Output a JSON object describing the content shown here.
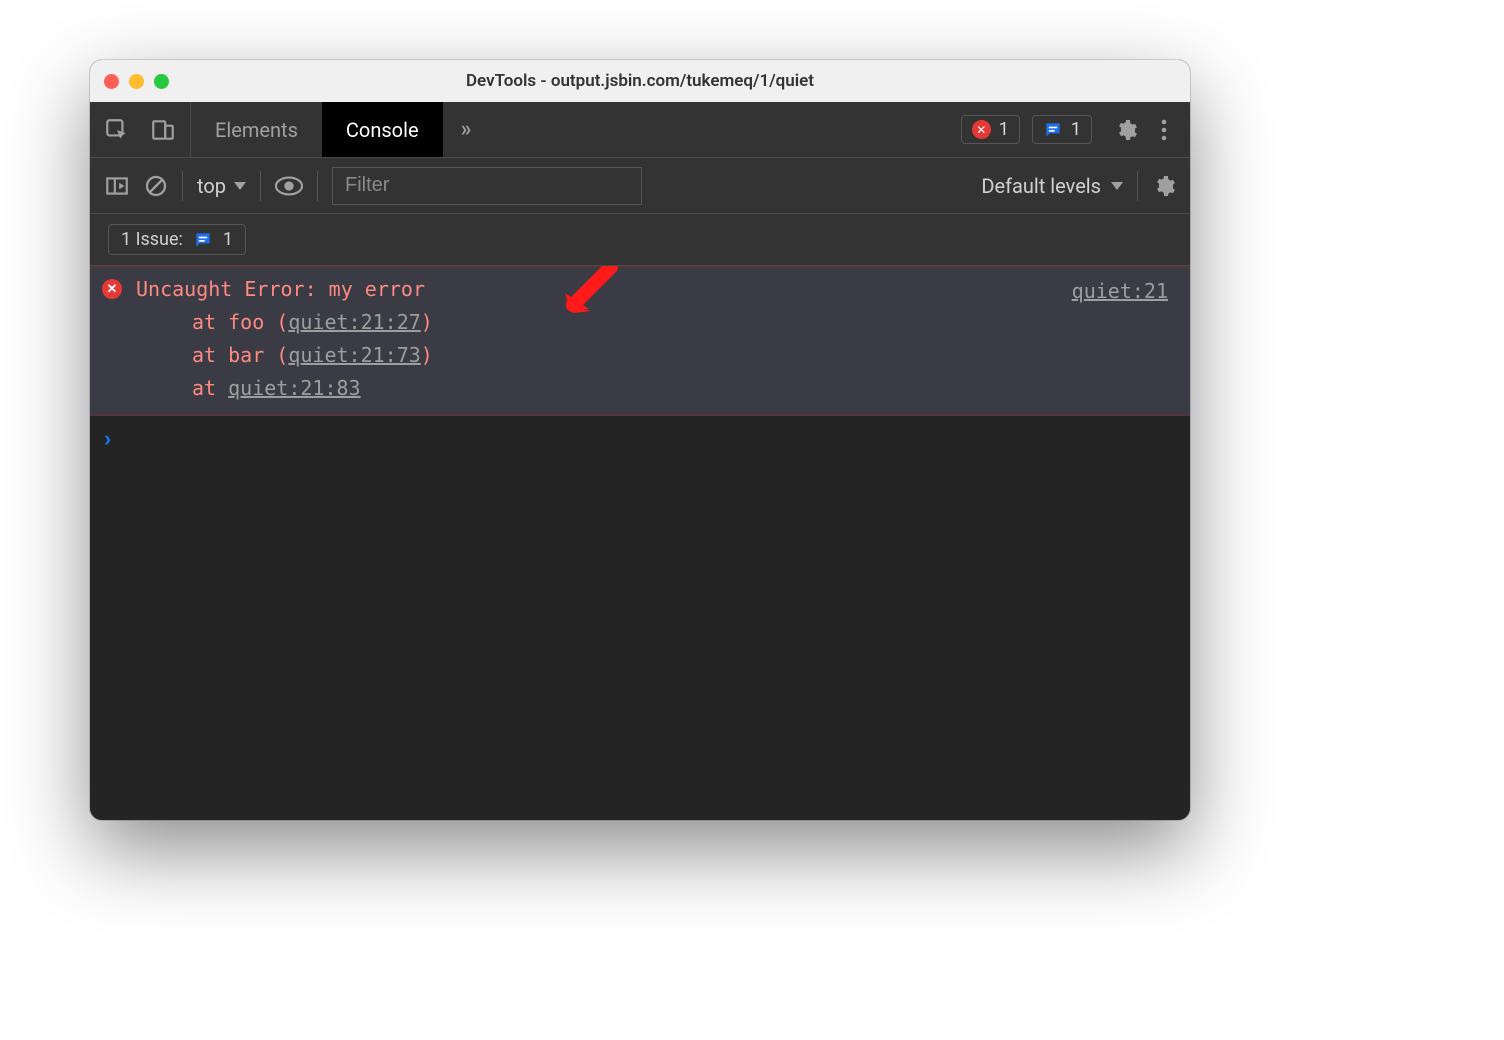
{
  "window": {
    "title": "DevTools - output.jsbin.com/tukemeq/1/quiet"
  },
  "tabs": {
    "elements": "Elements",
    "console": "Console",
    "expand_glyph": "»"
  },
  "badges": {
    "error_count": "1",
    "issue_count": "1"
  },
  "toolbar": {
    "context": "top",
    "filter_placeholder": "Filter",
    "levels": "Default levels"
  },
  "issuebar": {
    "label": "1 Issue:",
    "count": "1"
  },
  "error": {
    "message": "Uncaught Error: my error",
    "source_link": "quiet:21",
    "frames": [
      {
        "prefix": "at foo (",
        "link": "quiet:21:27",
        "suffix": ")"
      },
      {
        "prefix": "at bar (",
        "link": "quiet:21:73",
        "suffix": ")"
      },
      {
        "prefix": "at ",
        "link": "quiet:21:83",
        "suffix": ""
      }
    ]
  }
}
